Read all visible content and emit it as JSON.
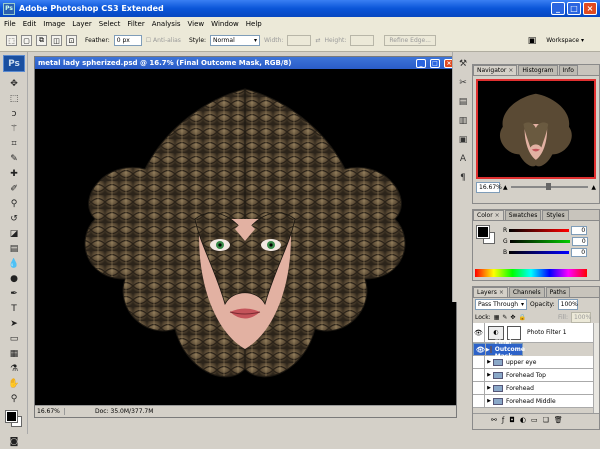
{
  "app": {
    "title": "Adobe Photoshop CS3 Extended",
    "logo": "Ps",
    "controls": {
      "minimize": "_",
      "maximize": "□",
      "close": "×"
    }
  },
  "menu": [
    "File",
    "Edit",
    "Image",
    "Layer",
    "Select",
    "Filter",
    "Analysis",
    "View",
    "Window",
    "Help"
  ],
  "options": {
    "feather_label": "Feather:",
    "feather_value": "0 px",
    "antialias_label": "Anti-alias",
    "style_label": "Style:",
    "style_value": "Normal",
    "width_label": "Width:",
    "height_label": "Height:",
    "refine_edge": "Refine Edge...",
    "workspace": "Workspace"
  },
  "document": {
    "title": "metal lady spherized.psd @ 16.7% (Final Outcome Mask, RGB/8)",
    "zoom": "16.67%",
    "doc_size": "Doc: 35.0M/377.7M"
  },
  "navigator": {
    "tabs": [
      "Navigator",
      "Histogram",
      "Info"
    ],
    "active": "Navigator",
    "zoom": "16.67%"
  },
  "color": {
    "tabs": [
      "Color",
      "Swatches",
      "Styles"
    ],
    "channels": [
      {
        "label": "R",
        "value": "0",
        "color": "#e02020"
      },
      {
        "label": "G",
        "value": "0",
        "color": "#20a020"
      },
      {
        "label": "B",
        "value": "0",
        "color": "#2030d0"
      }
    ]
  },
  "layers": {
    "tabs": [
      "Layers",
      "Channels",
      "Paths"
    ],
    "blend_mode": "Pass Through",
    "opacity_label": "Opacity:",
    "opacity": "100%",
    "lock_label": "Lock:",
    "fill_label": "Fill:",
    "fill": "100%",
    "rows": [
      {
        "name": "Photo Filter 1",
        "visible": true,
        "selected": false,
        "kind": "adjustment"
      },
      {
        "name": "Final Outcome Mask",
        "visible": true,
        "selected": true,
        "kind": "group"
      },
      {
        "name": "upper eye",
        "visible": false,
        "selected": false,
        "kind": "group"
      },
      {
        "name": "Forehead Top",
        "visible": false,
        "selected": false,
        "kind": "group"
      },
      {
        "name": "Forehead",
        "visible": false,
        "selected": false,
        "kind": "group"
      },
      {
        "name": "Forehead Middle",
        "visible": false,
        "selected": false,
        "kind": "group"
      }
    ]
  }
}
